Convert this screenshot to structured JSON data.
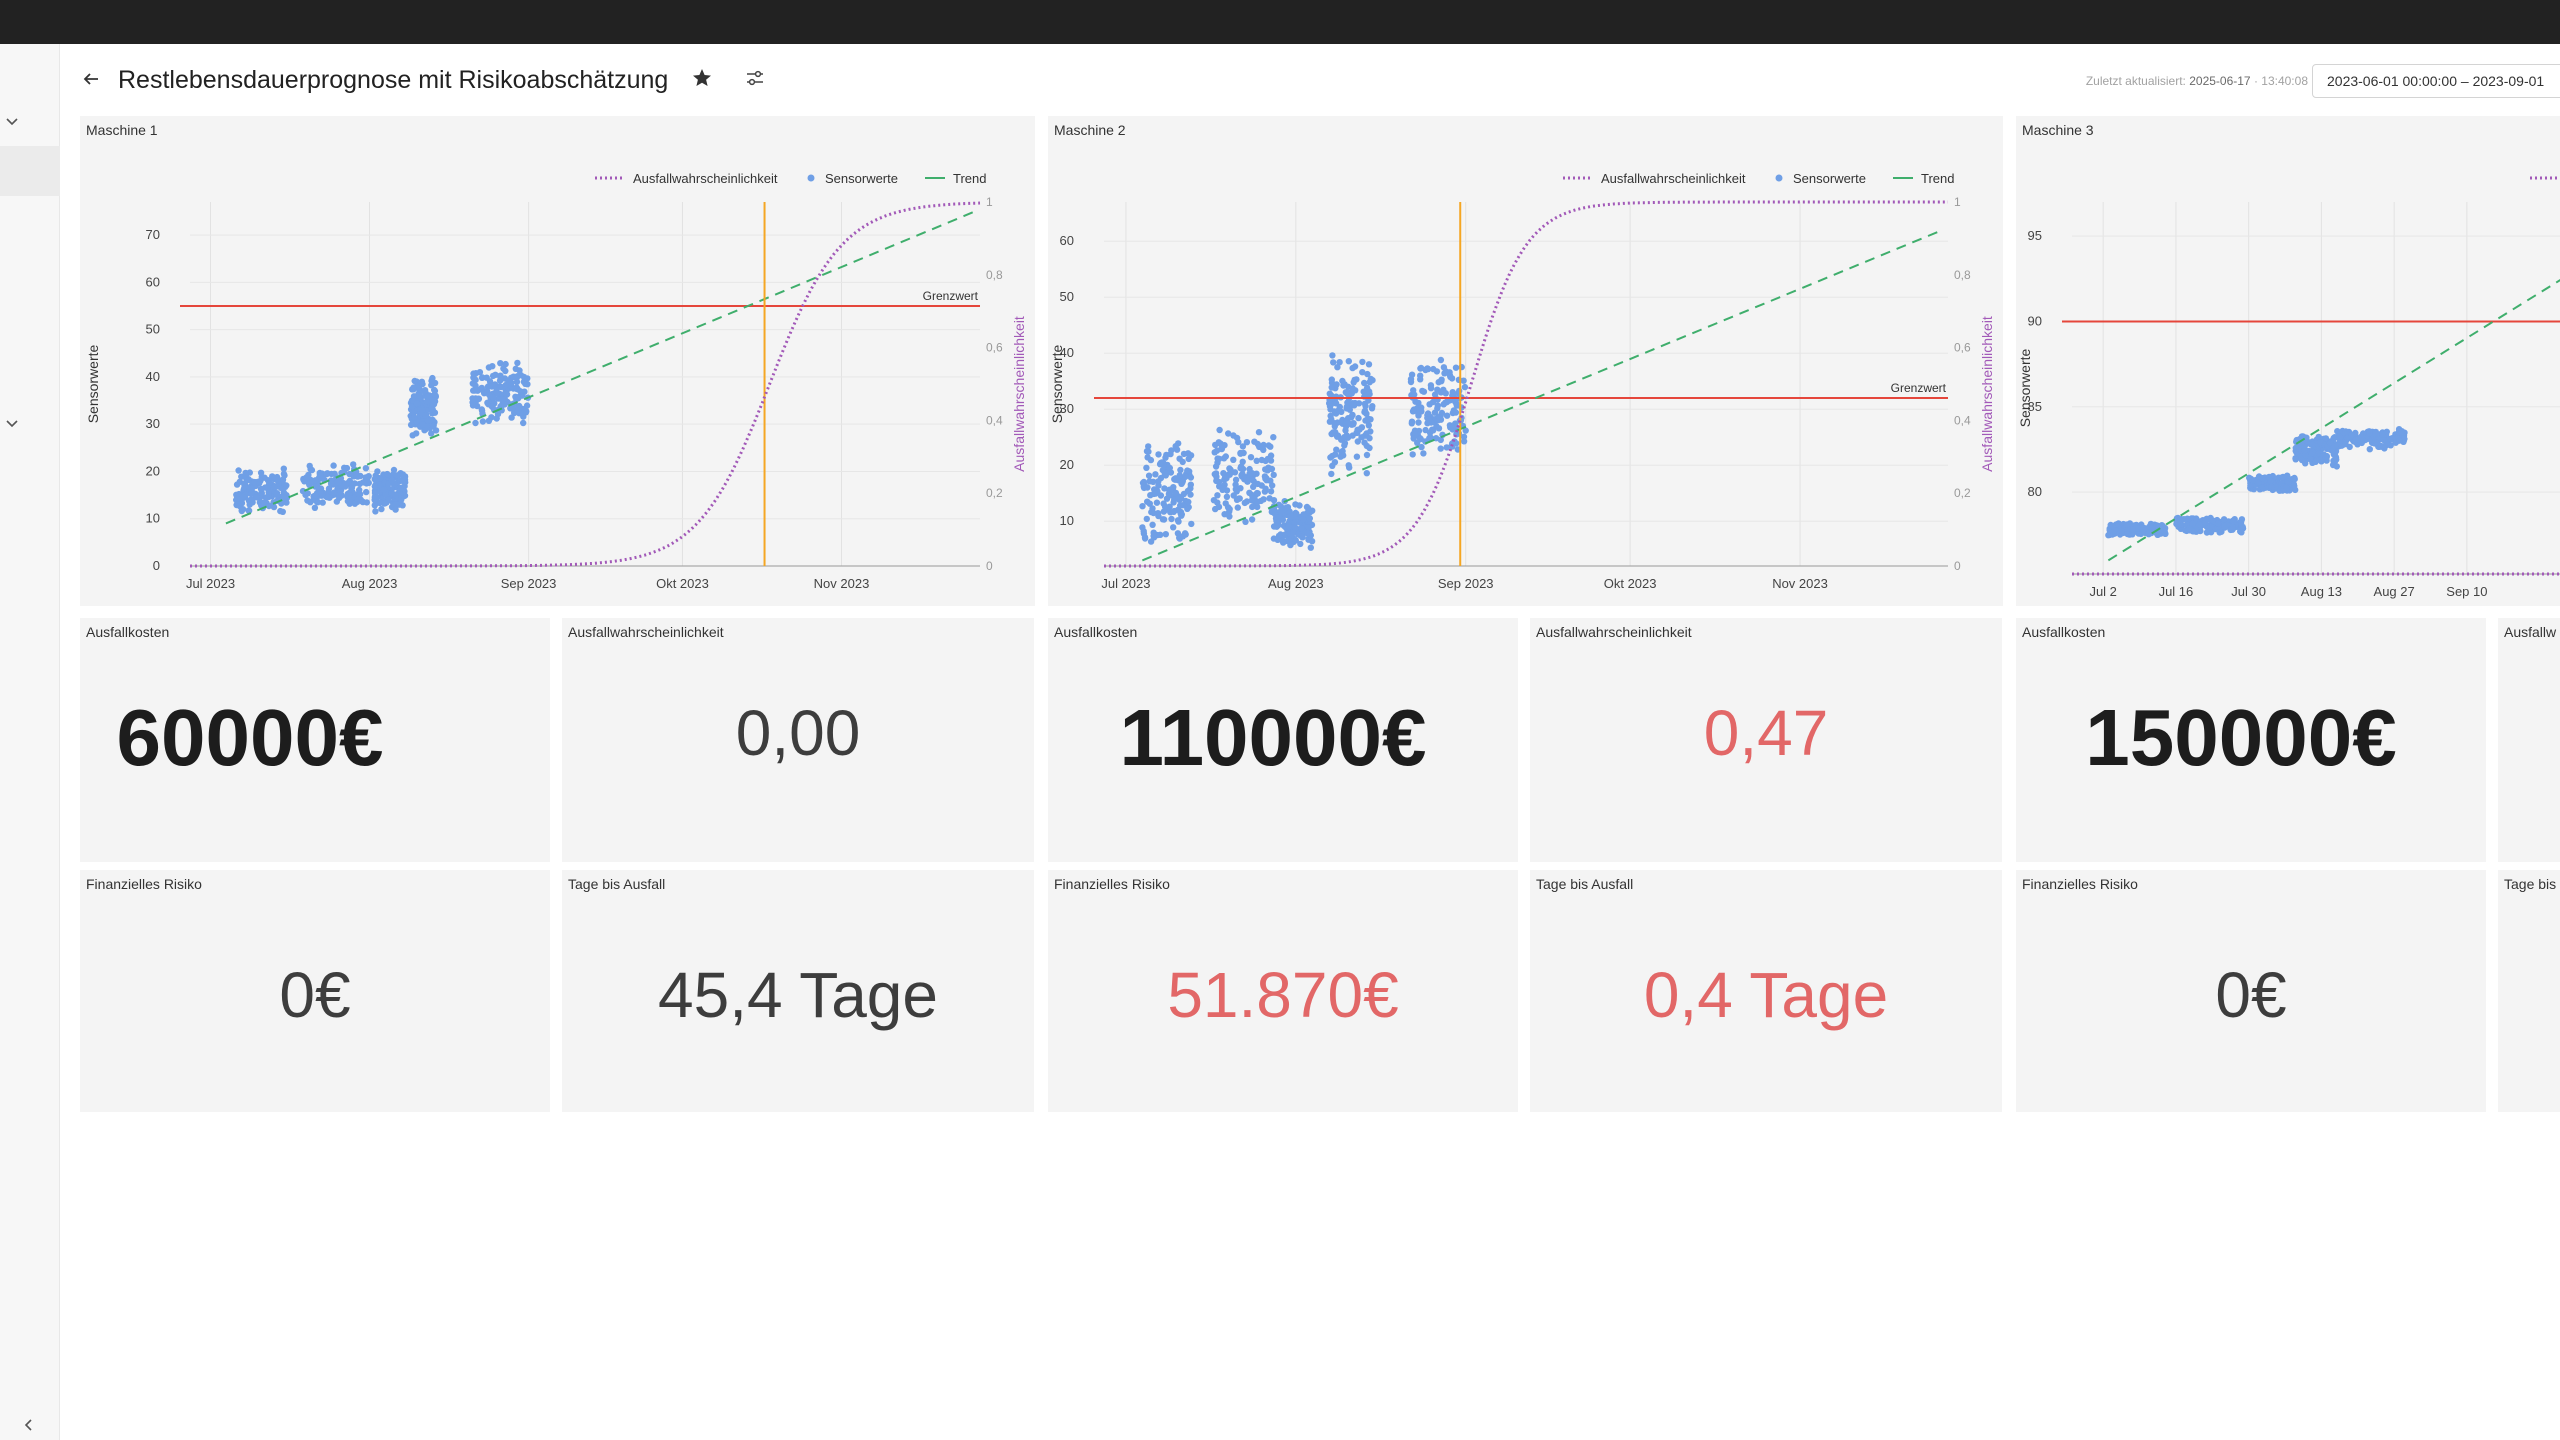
{
  "header": {
    "title": "Restlebensdauerprognose mit Risikoabschätzung",
    "updated_label": "Zuletzt aktualisiert:",
    "updated_date": "2025-06-17",
    "updated_time": "13:40:08",
    "time_range": "2023-06-01 00:00:00 – 2023-09-01"
  },
  "colors": {
    "sensor": "#6f9fe6",
    "trend": "#3fae6c",
    "probability": "#a259b8",
    "threshold": "#e5463b",
    "failure_marker": "#f5a623",
    "alert": "#e26767"
  },
  "legend": [
    "Ausfallwahrscheinlichkeit",
    "Sensorwerte",
    "Trend"
  ],
  "charts": [
    {
      "title": "Maschine 1",
      "ylabel": "Sensorwerte",
      "y2label": "Ausfallwahrscheinlichkeit",
      "threshold_label": "Grenzwert",
      "xlim": [
        "2023-06-27",
        "2023-11-28"
      ],
      "ylim": [
        0,
        77
      ],
      "y_ticks": [
        "0",
        "10",
        "20",
        "30",
        "40",
        "50",
        "60",
        "70"
      ],
      "y2_ticks": [
        "0",
        "0,2",
        "0,4",
        "0,6",
        "0,8",
        "1"
      ],
      "x_ticks": [
        {
          "date": "2023-07-01",
          "label": "Jul 2023"
        },
        {
          "date": "2023-08-01",
          "label": "Aug 2023"
        },
        {
          "date": "2023-09-01",
          "label": "Sep 2023"
        },
        {
          "date": "2023-10-01",
          "label": "Okt 2023"
        },
        {
          "date": "2023-11-01",
          "label": "Nov 2023"
        }
      ],
      "threshold": 55,
      "failure_date": "2023-10-17",
      "trend": {
        "start": [
          "2023-07-04",
          9
        ],
        "end": [
          "2023-11-27",
          75
        ]
      },
      "prob_center": "2023-10-18",
      "prob_width_days": 7,
      "clusters": [
        {
          "x": [
            "2023-07-06",
            "2023-07-16"
          ],
          "y": [
            11,
            21
          ]
        },
        {
          "x": [
            "2023-07-19",
            "2023-08-01"
          ],
          "y": [
            12,
            22
          ]
        },
        {
          "x": [
            "2023-08-02",
            "2023-08-08"
          ],
          "y": [
            11,
            21
          ]
        },
        {
          "x": [
            "2023-08-09",
            "2023-08-14"
          ],
          "y": [
            27,
            40
          ]
        },
        {
          "x": [
            "2023-08-21",
            "2023-09-01"
          ],
          "y": [
            29,
            44
          ]
        }
      ]
    },
    {
      "title": "Maschine 2",
      "ylabel": "Sensorwerte",
      "y2label": "Ausfallwahrscheinlichkeit",
      "threshold_label": "Grenzwert",
      "xlim": [
        "2023-06-27",
        "2023-11-28"
      ],
      "ylim": [
        2,
        67
      ],
      "y_ticks": [
        "10",
        "20",
        "30",
        "40",
        "50",
        "60"
      ],
      "y2_ticks": [
        "0",
        "0,2",
        "0,4",
        "0,6",
        "0,8",
        "1"
      ],
      "x_ticks": [
        {
          "date": "2023-07-01",
          "label": "Jul 2023"
        },
        {
          "date": "2023-08-01",
          "label": "Aug 2023"
        },
        {
          "date": "2023-09-01",
          "label": "Sep 2023"
        },
        {
          "date": "2023-10-01",
          "label": "Okt 2023"
        },
        {
          "date": "2023-11-01",
          "label": "Nov 2023"
        }
      ],
      "threshold": 32,
      "failure_date": "2023-08-31",
      "trend": {
        "start": [
          "2023-07-04",
          3
        ],
        "end": [
          "2023-11-27",
          62
        ]
      },
      "prob_center": "2023-09-02",
      "prob_width_days": 5,
      "clusters": [
        {
          "x": [
            "2023-07-04",
            "2023-07-13"
          ],
          "y": [
            5,
            25
          ]
        },
        {
          "x": [
            "2023-07-17",
            "2023-07-28"
          ],
          "y": [
            9,
            27
          ]
        },
        {
          "x": [
            "2023-07-28",
            "2023-08-04"
          ],
          "y": [
            5,
            14
          ]
        },
        {
          "x": [
            "2023-08-07",
            "2023-08-15"
          ],
          "y": [
            18,
            40
          ]
        },
        {
          "x": [
            "2023-08-22",
            "2023-09-01"
          ],
          "y": [
            20,
            40
          ]
        }
      ]
    },
    {
      "title": "Maschine 3",
      "ylabel": "Sensorwerte",
      "y2label": "",
      "threshold_label": "",
      "xlim": [
        "2023-06-26",
        "2023-10-01"
      ],
      "ylim": [
        75.2,
        97
      ],
      "y_ticks": [
        "80",
        "85",
        "90",
        "95"
      ],
      "y2_ticks": [],
      "x_ticks": [
        {
          "date": "2023-07-02",
          "label": "Jul 2"
        },
        {
          "date": "2023-07-16",
          "label": "Jul 16"
        },
        {
          "date": "2023-07-30",
          "label": "Jul 30"
        },
        {
          "date": "2023-08-13",
          "label": "Aug 13"
        },
        {
          "date": "2023-08-27",
          "label": "Aug 27"
        },
        {
          "date": "2023-09-10",
          "label": "Sep 10"
        }
      ],
      "threshold": 90,
      "failure_date": "",
      "trend": {
        "start": [
          "2023-07-03",
          76
        ],
        "end": [
          "2023-10-01",
          93
        ]
      },
      "prob_center": "2023-12-30",
      "prob_width_days": 5,
      "clusters": [
        {
          "x": [
            "2023-07-03",
            "2023-07-14"
          ],
          "y": [
            77.4,
            78.2
          ]
        },
        {
          "x": [
            "2023-07-16",
            "2023-07-29"
          ],
          "y": [
            77.6,
            78.6
          ]
        },
        {
          "x": [
            "2023-07-30",
            "2023-08-08"
          ],
          "y": [
            80,
            81
          ]
        },
        {
          "x": [
            "2023-08-08",
            "2023-08-16"
          ],
          "y": [
            81.5,
            83.5
          ]
        },
        {
          "x": [
            "2023-08-16",
            "2023-08-29"
          ],
          "y": [
            82.5,
            83.8
          ]
        }
      ]
    }
  ],
  "machines": [
    {
      "cost_label": "Ausfallkosten",
      "cost": "60000€",
      "prob_label": "Ausfallwahrscheinlichkeit",
      "prob": "0,00",
      "risk_label": "Finanzielles Risiko",
      "risk": "0€",
      "days_label": "Tage bis Ausfall",
      "days": "45,4 Tage"
    },
    {
      "cost_label": "Ausfallkosten",
      "cost": "110000€",
      "prob_label": "Ausfallwahrscheinlichkeit",
      "prob": "0,47",
      "risk_label": "Finanzielles Risiko",
      "risk": "51.870€",
      "days_label": "Tage bis Ausfall",
      "days": "0,4 Tage"
    },
    {
      "cost_label": "Ausfallkosten",
      "cost": "150000€",
      "prob_label": "Ausfallw",
      "prob": "",
      "risk_label": "Finanzielles Risiko",
      "risk": "0€",
      "days_label": "Tage bis",
      "days": ""
    }
  ]
}
